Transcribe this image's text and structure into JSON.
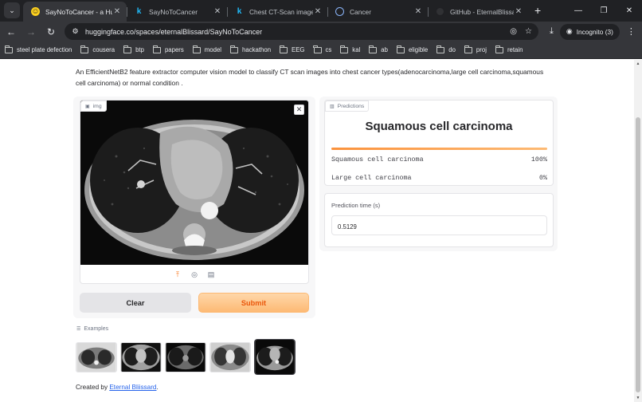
{
  "browser": {
    "tabs": [
      {
        "title": "SayNoToCancer - a Hugging",
        "favicon": "huggingface-icon",
        "active": true
      },
      {
        "title": "SayNoToCancer",
        "favicon": "kaggle-icon",
        "active": false
      },
      {
        "title": "Chest CT-Scan images D",
        "favicon": "kaggle-icon",
        "active": false
      },
      {
        "title": "Cancer",
        "favicon": "globe-icon",
        "active": false
      },
      {
        "title": "GitHub - EternalBlissard/",
        "favicon": "github-icon",
        "active": false
      }
    ],
    "url": "huggingface.co/spaces/eternalBlissard/SayNoToCancer",
    "incognito_label": "Incognito (3)",
    "bookmarks": [
      "steel plate defection",
      "cousera",
      "btp",
      "papers",
      "model",
      "hackathon",
      "EEG",
      "cs",
      "kal",
      "ab",
      "eligible",
      "do",
      "proj",
      "retain"
    ]
  },
  "app": {
    "description": "An EfficientNetB2 feature extractor computer vision model to classify CT scan images into chest cancer types(adenocarcinoma,large cell carcinoma,squamous cell carcinoma) or normal condition .",
    "image_label": "img",
    "clear_label": "Clear",
    "submit_label": "Submit",
    "predictions_label": "Predictions",
    "predicted_class": "Squamous cell carcinoma",
    "confidences": [
      {
        "label": "Squamous cell carcinoma",
        "value": "100%",
        "fraction": 1.0
      },
      {
        "label": "Large cell carcinoma",
        "value": "0%",
        "fraction": 0.0
      }
    ],
    "prediction_time_label": "Prediction time (s)",
    "prediction_time_value": "0.5129",
    "examples_label": "Examples",
    "footer_prefix": "Created by ",
    "footer_link": "Eternal Bliissard",
    "footer_suffix": "."
  },
  "colors": {
    "accent_orange": "#f97316",
    "link_blue": "#2563eb",
    "chrome_dark": "#202124",
    "chrome_mid": "#35363a"
  }
}
